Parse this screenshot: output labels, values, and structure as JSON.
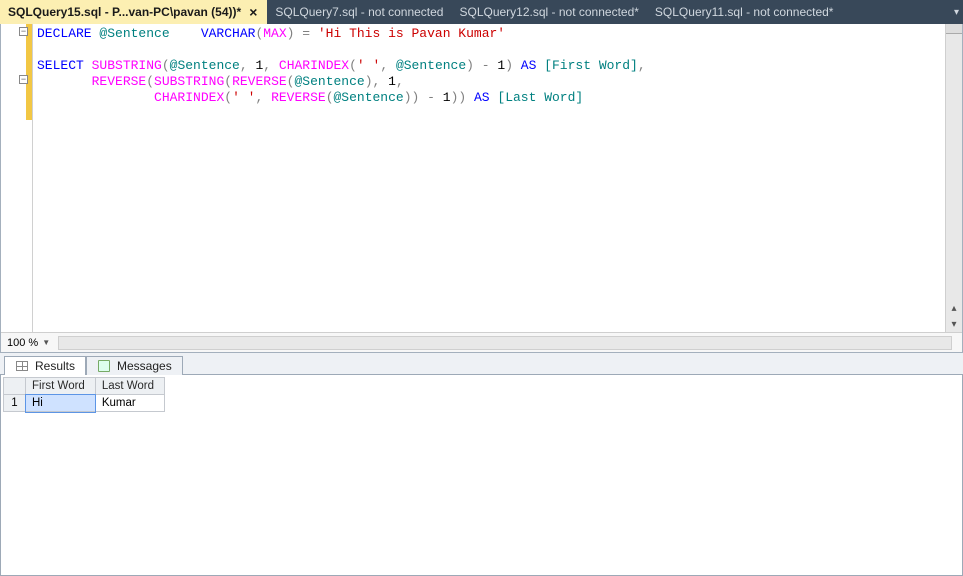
{
  "tabs": [
    {
      "label": "SQLQuery15.sql - P...van-PC\\pavan (54))*",
      "active": true
    },
    {
      "label": "SQLQuery7.sql - not connected",
      "active": false
    },
    {
      "label": "SQLQuery12.sql - not connected*",
      "active": false
    },
    {
      "label": "SQLQuery11.sql - not connected*",
      "active": false
    }
  ],
  "code": {
    "l1_declare": "DECLARE",
    "l1_var": " @Sentence    ",
    "l1_type": "VARCHAR",
    "l1_max": "MAX",
    "l1_eq": " = ",
    "l1_str": "'Hi This is Pavan Kumar'",
    "l3_select": "SELECT",
    "l3_substring": " SUBSTRING",
    "l3_p1_open": "(",
    "l3_var": "@Sentence",
    "l3_c1": ", ",
    "l3_n1": "1",
    "l3_c2": ", ",
    "l3_charindex": "CHARINDEX",
    "l3_p2_open": "(",
    "l3_sp": "' '",
    "l3_c3": ", ",
    "l3_var2": "@Sentence",
    "l3_p2_close": ")",
    "l3_minus": " - ",
    "l3_n2": "1",
    "l3_p1_close": ")",
    "l3_as": " AS",
    "l3_alias": " [First Word]",
    "l3_tail": ",",
    "l4_pad": "       ",
    "l4_reverse": "REVERSE",
    "l4_p1": "(",
    "l4_substring": "SUBSTRING",
    "l4_p2": "(",
    "l4_reverse2": "REVERSE",
    "l4_p3": "(",
    "l4_var": "@Sentence",
    "l4_p3c": ")",
    "l4_c1": ", ",
    "l4_n1": "1",
    "l4_tail": ",",
    "l5_pad": "               ",
    "l5_charindex": "CHARINDEX",
    "l5_p1": "(",
    "l5_sp": "' '",
    "l5_c1": ", ",
    "l5_reverse": "REVERSE",
    "l5_p2": "(",
    "l5_var": "@Sentence",
    "l5_p2c": ")",
    "l5_p1c": ")",
    "l5_minus": " - ",
    "l5_n1": "1",
    "l5_pA": ")",
    "l5_pB": ")",
    "l5_as": " AS",
    "l5_alias": " [Last Word]"
  },
  "zoom": "100 %",
  "resultsTabs": {
    "results": "Results",
    "messages": "Messages"
  },
  "grid": {
    "headers": [
      "First Word",
      "Last Word"
    ],
    "rows": [
      {
        "n": "1",
        "cells": [
          "Hi",
          "Kumar"
        ]
      }
    ]
  }
}
